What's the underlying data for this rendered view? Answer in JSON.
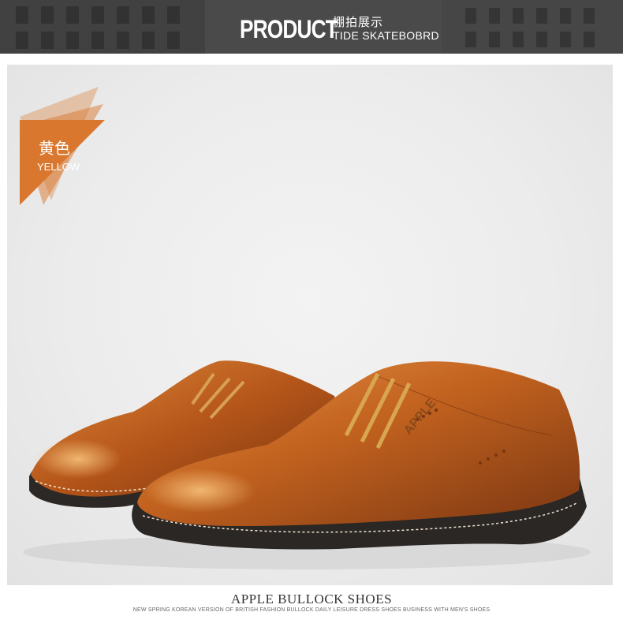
{
  "header": {
    "title_main": "PRODUCT",
    "title_cn": "棚拍展示",
    "title_en": "TIDE SKATEBOBRD"
  },
  "badge": {
    "label_cn": "黄色",
    "label_en": "YELLOW",
    "color": "#d9772e"
  },
  "product_image": {
    "brand_mark": "APPLE",
    "subject": "shoe-photo"
  },
  "footer": {
    "title": "APPLE BULLOCK SHOES",
    "subtitle": "NEW SPRING KOREAN VERSION OF BRITISH FASHION BULLOCK DAILY LEISURE DRESS SHOES BUSINESS WITH MEN'S SHOES"
  },
  "colors": {
    "banner": "#4f4f4f",
    "leather": "#c8641e",
    "sole": "#2b2725"
  }
}
